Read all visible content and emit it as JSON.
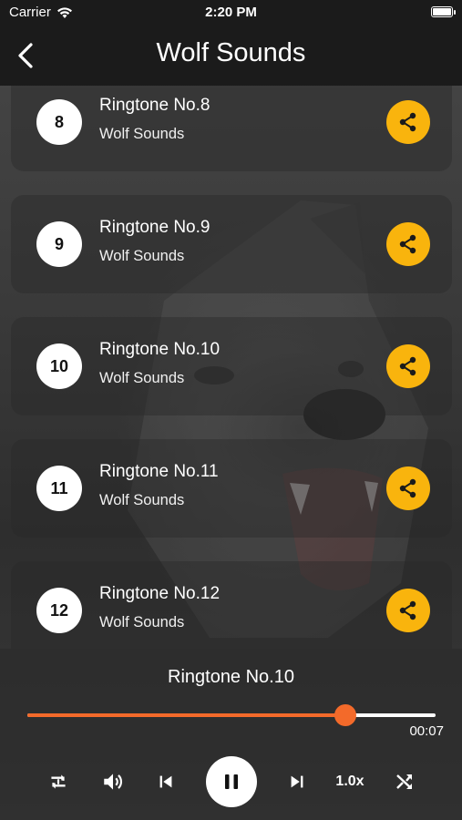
{
  "status_bar": {
    "carrier": "Carrier",
    "time": "2:20 PM",
    "battery_level": 1.0
  },
  "nav": {
    "title": "Wolf Sounds",
    "back_icon": "chevron-left-icon"
  },
  "ringtones": [
    {
      "number": "8",
      "title": "Ringtone No.8",
      "subtitle": "Wolf Sounds"
    },
    {
      "number": "9",
      "title": "Ringtone No.9",
      "subtitle": "Wolf Sounds"
    },
    {
      "number": "10",
      "title": "Ringtone No.10",
      "subtitle": "Wolf Sounds"
    },
    {
      "number": "11",
      "title": "Ringtone No.11",
      "subtitle": "Wolf Sounds"
    },
    {
      "number": "12",
      "title": "Ringtone No.12",
      "subtitle": "Wolf Sounds"
    }
  ],
  "player": {
    "now_playing": "Ringtone No.10",
    "progress": 0.78,
    "elapsed": "00:07",
    "speed": "1.0x",
    "icons": [
      "repeat-icon",
      "volume-icon",
      "previous-icon",
      "pause-icon",
      "next-icon",
      "shuffle-icon"
    ]
  },
  "colors": {
    "accent_share": "#f9b40d",
    "progress": "#f36a2a",
    "bar_background": "#1b1b1b"
  }
}
